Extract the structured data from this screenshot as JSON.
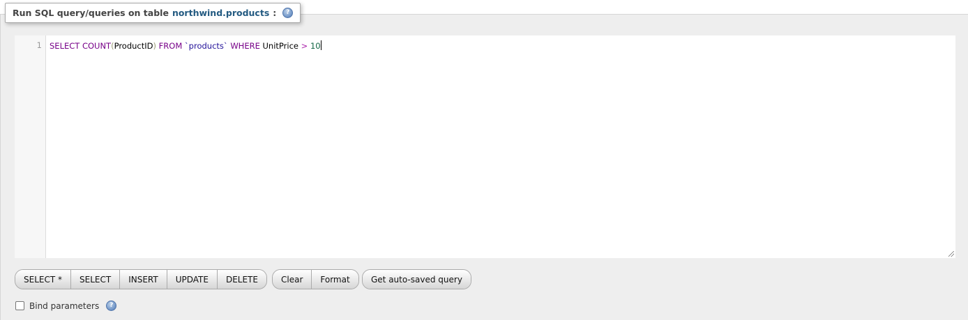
{
  "legend": {
    "prefix": "Run SQL query/queries on table ",
    "table_link": "northwind.products",
    "suffix": ":",
    "help_icon": "help-icon"
  },
  "editor": {
    "line_number": "1",
    "code_tokens": {
      "select_kw": "SELECT",
      "count_kw": "COUNT",
      "open_paren": "(",
      "column": "ProductID",
      "close_paren": ")",
      "from_kw": "FROM",
      "table": "`products`",
      "where_kw": "WHERE",
      "where_col": "UnitPrice",
      "operator": ">",
      "value": "10"
    }
  },
  "buttons": {
    "group1": [
      "SELECT *",
      "SELECT",
      "INSERT",
      "UPDATE",
      "DELETE"
    ],
    "group2": [
      "Clear",
      "Format"
    ],
    "group3": [
      "Get auto-saved query"
    ]
  },
  "bind_params": {
    "label": "Bind parameters",
    "checked": false,
    "help_icon": "help-icon"
  },
  "colors": {
    "link": "#235a81",
    "keyword": "#770088",
    "string": "#221199",
    "number": "#116644",
    "operator": "#aa22aa",
    "panel_bg": "#eeeeee"
  }
}
